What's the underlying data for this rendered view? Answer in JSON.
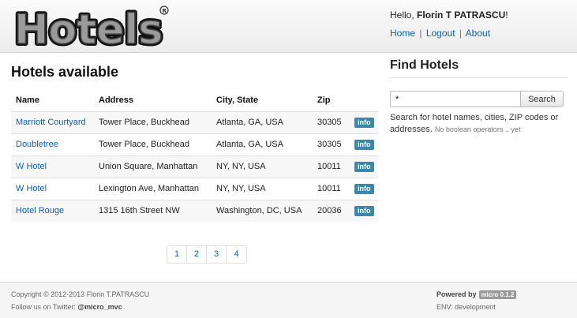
{
  "header": {
    "logo_text": "Hotels",
    "greeting_prefix": "Hello,",
    "user_name": "Florin T PATRASCU",
    "greeting_suffix": "!",
    "nav": [
      "Home",
      "Logout",
      "About"
    ],
    "nav_separator": "|"
  },
  "main": {
    "title": "Hotels available",
    "columns": [
      "Name",
      "Address",
      "City, State",
      "Zip"
    ],
    "rows": [
      {
        "name": "Marriott Courtyard",
        "address": "Tower Place, Buckhead",
        "city": "Atlanta, GA, USA",
        "zip": "30305",
        "action": "info"
      },
      {
        "name": "Doubletree",
        "address": "Tower Place, Buckhead",
        "city": "Atlanta, GA, USA",
        "zip": "30305",
        "action": "info"
      },
      {
        "name": "W Hotel",
        "address": "Union Square, Manhattan",
        "city": "NY, NY, USA",
        "zip": "10011",
        "action": "info"
      },
      {
        "name": "W Hotel",
        "address": "Lexington Ave, Manhattan",
        "city": "NY, NY, USA",
        "zip": "10011",
        "action": "info"
      },
      {
        "name": "Hotel Rouge",
        "address": "1315 16th Street NW",
        "city": "Washington, DC, USA",
        "zip": "20036",
        "action": "info"
      }
    ],
    "pages": [
      "1",
      "2",
      "3",
      "4"
    ]
  },
  "sidebar": {
    "title": "Find Hotels",
    "search_value": "*",
    "search_button": "Search",
    "help_text": "Search for hotel names, cities, ZIP codes or addresses.",
    "help_note": "No boolean operators .. yet"
  },
  "footer": {
    "copyright": "Copyright © 2012-2013 Florin T.PATRASCU",
    "follow_prefix": "Follow us on Twitter:",
    "twitter": "@micro_mvc",
    "powered_by": "Powered by",
    "badge": "micro 0.1.2",
    "env": "ENV: development"
  },
  "colors": {
    "link": "#0f5fa8",
    "info_badge": "#3a87ad",
    "footer_badge": "#999999"
  }
}
